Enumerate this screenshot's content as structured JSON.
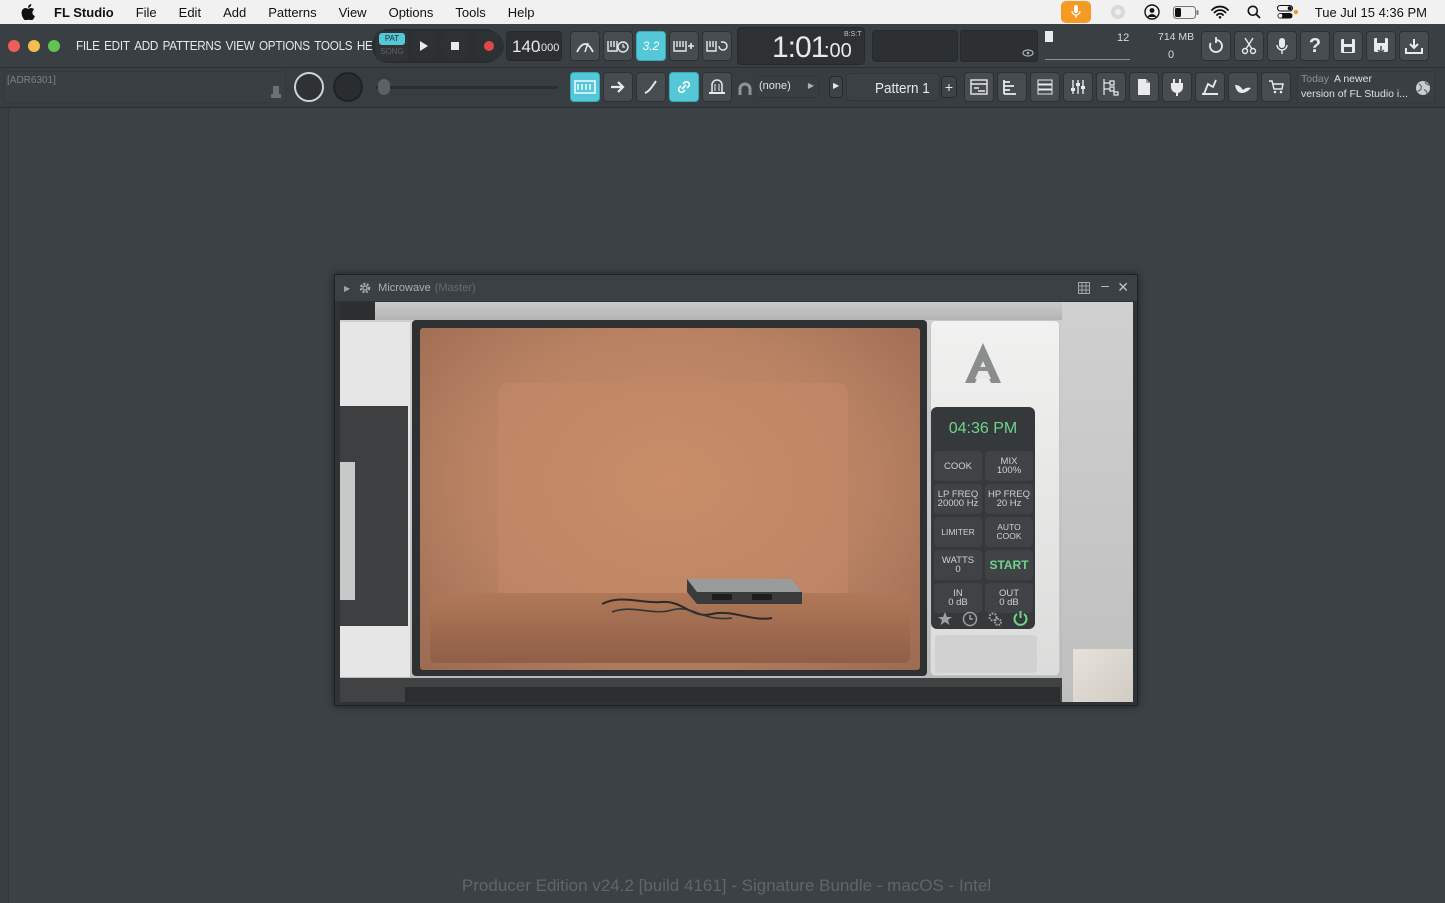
{
  "menubar": {
    "app_name": "FL Studio",
    "items": [
      "File",
      "Edit",
      "Add",
      "Patterns",
      "View",
      "Options",
      "Tools",
      "Help"
    ],
    "clock": "Tue Jul 15  4:36 PM"
  },
  "fl": {
    "menu": [
      "FILE",
      "EDIT",
      "ADD",
      "PATTERNS",
      "VIEW",
      "OPTIONS",
      "TOOLS",
      "HELP"
    ],
    "pat_label": "PAT",
    "song_label": "SONG",
    "tempo": "140",
    "tempo_frac": ".000",
    "time_main": "1:01",
    "time_sub": ":00",
    "time_label": "B:S:T",
    "cpu_value": "12",
    "mem_value": "714 MB",
    "poly_value": "0",
    "hint_field": "[ADR6301]",
    "snap_value": "(none)",
    "pattern_name": "Pattern 1",
    "news_today": "Today",
    "news_text_1": "A newer",
    "news_text_2": "version of FL Studio i...",
    "snap_indicator": "3.2"
  },
  "plugin": {
    "title": "Microwave",
    "title_suffix": "(Master)",
    "clock": "04:36 PM",
    "buttons": {
      "cook": "COOK",
      "mix": "MIX",
      "mix_value": "100%",
      "lp": "LP FREQ",
      "lp_value": "20000 Hz",
      "hp": "HP FREQ",
      "hp_value": "20 Hz",
      "limiter": "LIMITER",
      "auto_cook": "AUTO COOK",
      "watts": "WATTS",
      "watts_value": "0",
      "start": "START",
      "in": "IN",
      "in_value": "0 dB",
      "out": "OUT",
      "out_value": "0 dB"
    }
  },
  "footer": {
    "edition": "Producer Edition v24.2 [build 4161] - Signature Bundle - macOS - Intel"
  },
  "colors": {
    "accent_cyan": "#55c8d8",
    "lcd_green": "#6ed58a",
    "record_red": "#e04848",
    "mic_orange": "#f59a23"
  }
}
